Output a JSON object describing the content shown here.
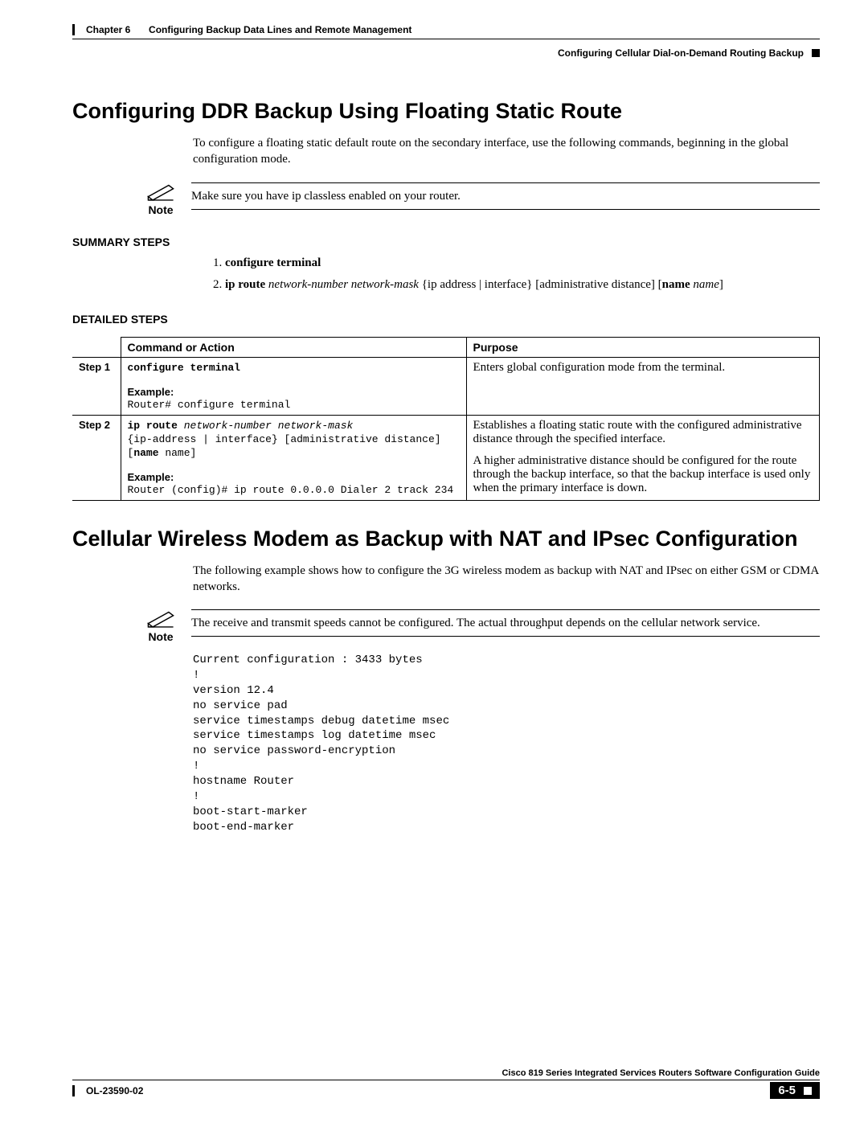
{
  "header": {
    "chapter_ref": "Chapter 6",
    "chapter_title": "Configuring Backup Data Lines and Remote Management",
    "section_right": "Configuring Cellular Dial-on-Demand Routing Backup"
  },
  "h1_ddr": "Configuring DDR Backup Using Floating Static Route",
  "intro_ddr": "To configure a floating static default route on the secondary interface, use the following commands, beginning in the global configuration mode.",
  "note_label": "Note",
  "note_ddr": "Make sure you have ip classless enabled on your router.",
  "summary_heading": "SUMMARY STEPS",
  "summary": [
    {
      "bold": "configure terminal"
    },
    {
      "bold": "ip route ",
      "ital": "network-number network-mask",
      "rest_a": " {ip address | interface} [administrative distance] [",
      "name_bold": "name",
      "name_ital": "name",
      "rest_b": "]"
    }
  ],
  "detailed_heading": "DETAILED STEPS",
  "table": {
    "hdr_cmd": "Command or Action",
    "hdr_purpose": "Purpose",
    "step1_label": "Step 1",
    "step2_label": "Step 2",
    "step1": {
      "cmd": "configure terminal",
      "ex_label": "Example:",
      "ex": "Router# configure terminal",
      "purpose": "Enters global configuration mode from the terminal."
    },
    "step2": {
      "cmd_bold": "ip route ",
      "cmd_ital": "network-number network-mask",
      "cmd_line2": "{ip-address | interface} [administrative distance]",
      "cmd_line3_a": "[",
      "cmd_line3_name_b": "name",
      "cmd_line3_name_plain": " name]",
      "ex_label": "Example:",
      "ex": "Router (config)# ip route 0.0.0.0 Dialer 2 track 234",
      "purpose_p1": "Establishes a floating static route with the configured administrative distance through the specified interface.",
      "purpose_p2": "A higher administrative distance should be configured for the route through the backup interface, so that the backup interface is used only when the primary interface is down."
    }
  },
  "h1_cell": "Cellular Wireless Modem as Backup with NAT and IPsec Configuration",
  "intro_cell": "The following example shows how to configure the 3G wireless modem as backup with NAT and IPsec on either GSM or CDMA networks.",
  "note_cell": "The receive and transmit speeds cannot be configured. The actual throughput depends on the cellular network service.",
  "config": "Current configuration : 3433 bytes\n!\nversion 12.4\nno service pad\nservice timestamps debug datetime msec\nservice timestamps log datetime msec\nno service password-encryption\n!\nhostname Router\n!\nboot-start-marker\nboot-end-marker",
  "footer": {
    "guide_title": "Cisco 819 Series Integrated Services Routers Software Configuration Guide",
    "doc_id": "OL-23590-02",
    "page_no": "6-5"
  }
}
